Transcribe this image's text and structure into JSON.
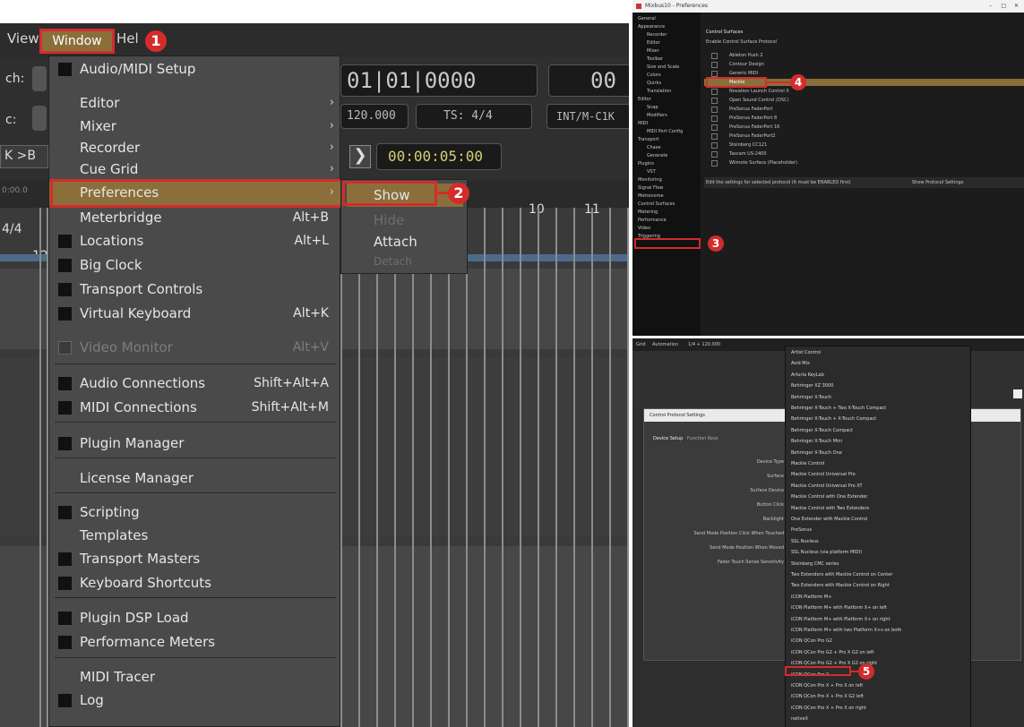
{
  "menubar": {
    "view_label": "View",
    "window_label": "Window",
    "help_label": "Hel"
  },
  "left_labels": {
    "a": "ch:",
    "b": "c:",
    "c": "K >B",
    "d": "4/4",
    "e": "12",
    "f": "0:00.0"
  },
  "transport": {
    "bbt": "01|01|0000",
    "clock_right": "00",
    "tempo": "120.000",
    "ts": "TS: 4/4",
    "sync": "INT/M-C1K",
    "timer": "00:00:05:00",
    "ruler_10": "10",
    "ruler_11": "11"
  },
  "window_menu": [
    {
      "label": "Audio/MIDI Setup",
      "check": true
    },
    {
      "label": "Editor",
      "arrow": true
    },
    {
      "label": "Mixer",
      "arrow": true
    },
    {
      "label": "Recorder",
      "arrow": true
    },
    {
      "label": "Cue Grid",
      "arrow": true
    },
    {
      "label": "Preferences",
      "arrow": true,
      "highlight": true
    },
    {
      "label": "Meterbridge",
      "shortcut": "Alt+B"
    },
    {
      "label": "Locations",
      "shortcut": "Alt+L",
      "check": true
    },
    {
      "label": "Big Clock",
      "check": true
    },
    {
      "label": "Transport Controls",
      "check": true
    },
    {
      "label": "Virtual Keyboard",
      "shortcut": "Alt+K",
      "check": true
    },
    {
      "label": "Video Monitor",
      "shortcut": "Alt+V",
      "check": true,
      "disabled": true
    },
    {
      "label": "Audio Connections",
      "shortcut": "Shift+Alt+A",
      "check": true
    },
    {
      "label": "MIDI Connections",
      "shortcut": "Shift+Alt+M",
      "check": true
    },
    {
      "label": "Plugin Manager",
      "check": true
    },
    {
      "label": "License Manager"
    },
    {
      "label": "Scripting",
      "check": true
    },
    {
      "label": "Templates"
    },
    {
      "label": "Transport Masters",
      "check": true
    },
    {
      "label": "Keyboard Shortcuts",
      "check": true
    },
    {
      "label": "Plugin DSP Load",
      "check": true
    },
    {
      "label": "Performance Meters",
      "check": true
    },
    {
      "label": "MIDI Tracer"
    },
    {
      "label": "Log",
      "check": true
    }
  ],
  "submenu": {
    "show": "Show",
    "hide": "Hide",
    "attach": "Attach",
    "detach": "Detach"
  },
  "badges": [
    "1",
    "2",
    "3",
    "4",
    "5"
  ],
  "prefs_window": {
    "title": "Mixbus10 - Preferences",
    "sidebar": [
      "General",
      "Appearance",
      "Recorder",
      "Editor",
      "Mixer",
      "Toolbar",
      "Size and Scale",
      "Colors",
      "Quirks",
      "Translation",
      "Editor",
      "Snap",
      "Modifiers",
      "MIDI",
      "MIDI Port Config",
      "Transport",
      "Chase",
      "Generate",
      "Plugins",
      "VST",
      "Monitoring",
      "Signal Flow",
      "Metronome",
      "Control Surfaces",
      "Metering",
      "Performance",
      "Video",
      "Triggering"
    ],
    "section_title": "Control Surfaces",
    "header": "Enable  Control Surface Protocol",
    "protocols": [
      "Ableton Push 2",
      "Contour Design",
      "Generic MIDI",
      "Mackie",
      "Novation Launch Control X",
      "Open Sound Control (OSC)",
      "PreSonus FaderPort",
      "PreSonus FaderPort 8",
      "PreSonus FaderPort 16",
      "PreSonus FaderPort2",
      "Steinberg CC121",
      "Tascam US-2400",
      "Wiimote Surface (Placeholder)"
    ],
    "footer_left": "Edit the settings for selected protocol (it must be ENABLED first)",
    "footer_right": "Show Protocol Settings"
  },
  "bottom_panel": {
    "toolbar": [
      "Grid",
      "Automation",
      "1/4 + 120.000"
    ],
    "dialog_title": "Control Protocol Settings",
    "tabs": [
      "Device Setup",
      "Function Keys"
    ],
    "form_labels": [
      "Device Type",
      "Surface",
      "Surface Device",
      "Button Click",
      "Backlight",
      "Send Mode Position Click When Touched",
      "Send Mode Position When Moved",
      "Fader Touch Sense Sensitivity"
    ],
    "devices": [
      "Artist Control",
      "Avid Mix",
      "Arturia KeyLab",
      "Behringer XZ 3000",
      "Behringer X-Touch",
      "Behringer X-Touch + Two X-Touch Compact",
      "Behringer X-Touch + X-Touch Compact",
      "Behringer X-Touch Compact",
      "Behringer X-Touch Mini",
      "Behringer X-Touch One",
      "Mackie Control",
      "Mackie Control Universal Pro",
      "Mackie Control Universal Pro XT",
      "Mackie Control with One Extender",
      "Mackie Control with Two Extenders",
      "One Extender with Mackie Control",
      "PreSonus",
      "SSL Nucleus",
      "SSL Nucleus (via platform MIDI)",
      "Steinberg CMC series",
      "Two Extenders with Mackie Control on Center",
      "Two Extenders with Mackie Control on Right",
      "iCON Platform M+",
      "iCON Platform M+ with Platform X+ on left",
      "iCON Platform M+ with Platform X+ on right",
      "iCON Platform M+ with two Platform X+s on both",
      "iCON QCon Pro G2",
      "iCON QCon Pro G2 + Pro X G2 on left",
      "iCON QCon Pro G2 + Pro X G2 on right",
      "iCON QCon Pro X",
      "iCON QCon Pro X + Pro X on left",
      "iCON QCon Pro X + Pro X G2 left",
      "iCON QCon Pro X + Pro X on right",
      "nativeX"
    ]
  },
  "colors": {
    "highlight": "#8a6f3a",
    "annotation": "#d42b2b",
    "menu_bg": "#4a4a4a"
  }
}
